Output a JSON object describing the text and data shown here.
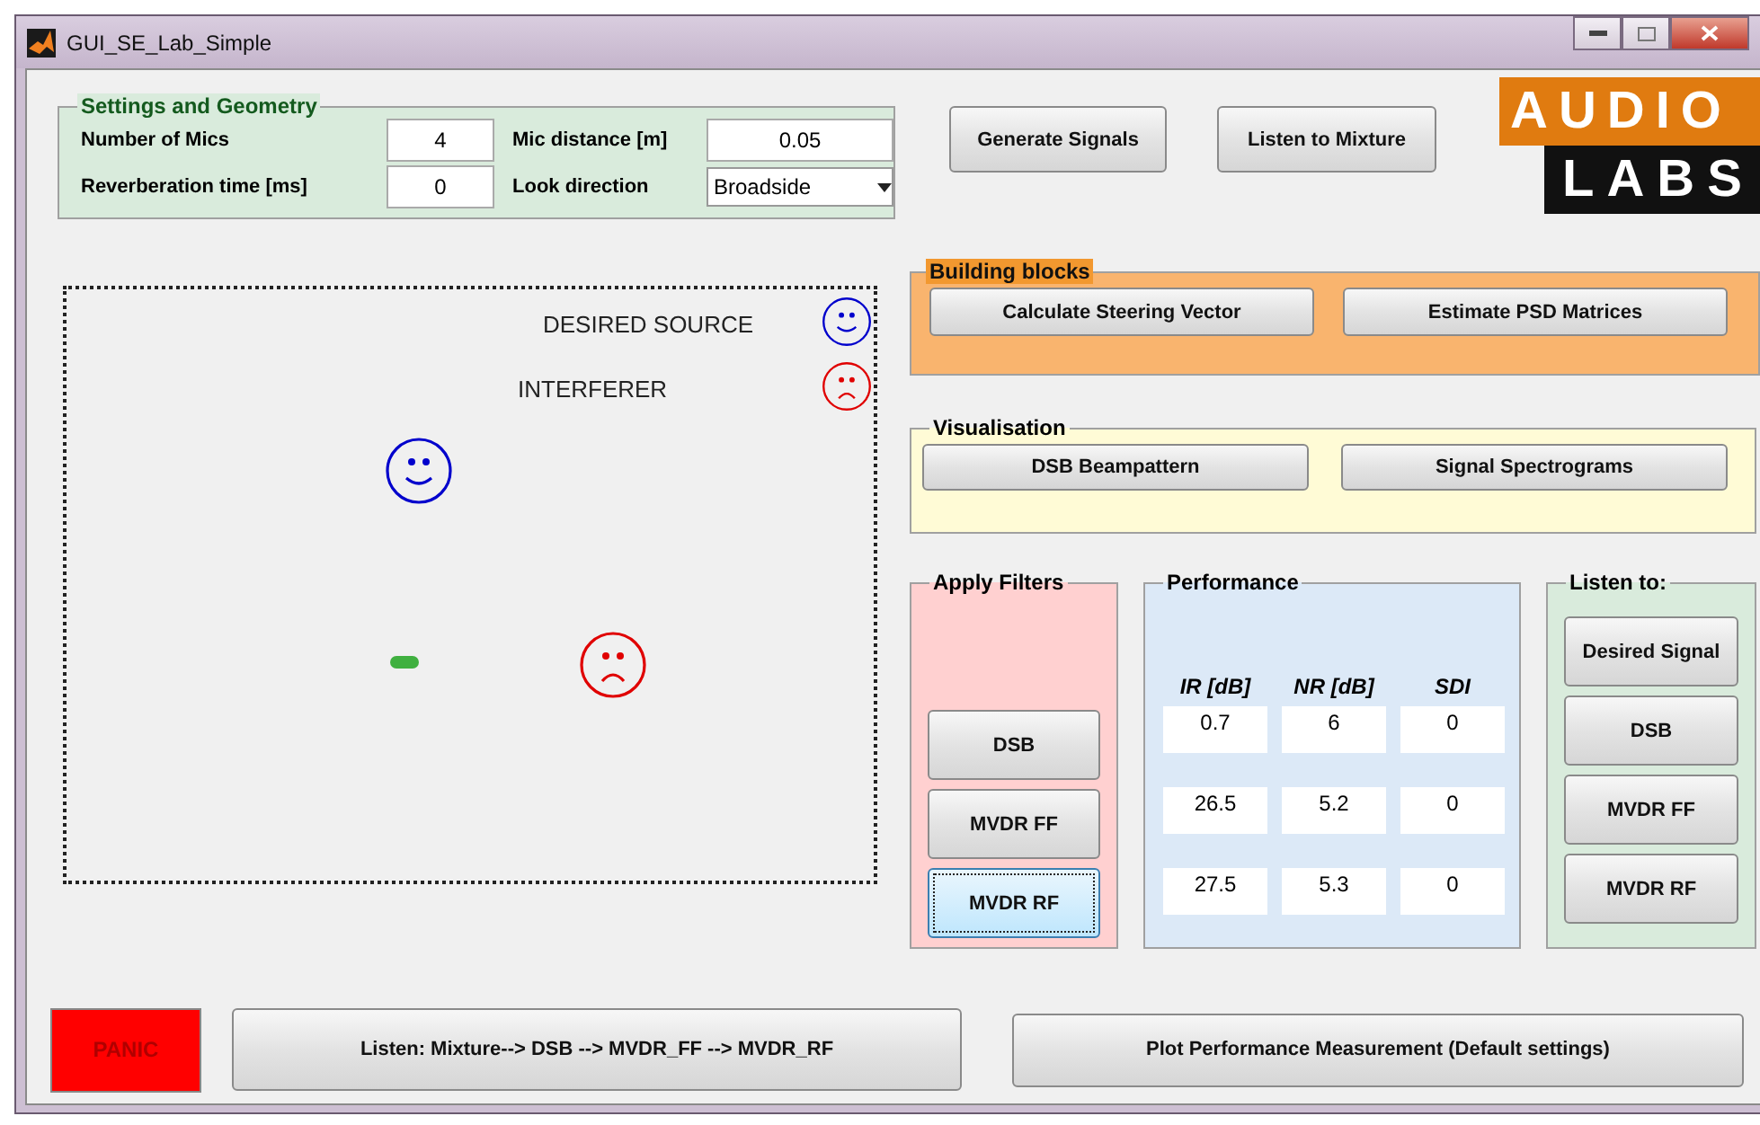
{
  "window": {
    "title": "GUI_SE_Lab_Simple"
  },
  "settings": {
    "title": "Settings and Geometry",
    "fields": [
      {
        "kind": "text",
        "label": "Number of Mics",
        "value": "4"
      },
      {
        "kind": "text",
        "label": "Mic distance [m]",
        "value": "0.05"
      },
      {
        "kind": "text",
        "label": "Reverberation time [ms]",
        "value": "0"
      },
      {
        "kind": "dropdown",
        "label": "Look direction",
        "value": "Broadside"
      }
    ]
  },
  "top_buttons": [
    "Generate Signals",
    "Listen to Mixture"
  ],
  "logo": {
    "line_1": "AUDIO",
    "line_2": "LABS"
  },
  "plot": {
    "legend": [
      {
        "label": "DESIRED SOURCE",
        "kind": "happy",
        "color": "#0000cc"
      },
      {
        "label": "INTERFERER",
        "kind": "sad",
        "color": "#e00000"
      }
    ]
  },
  "building_blocks": {
    "title": "Building blocks",
    "buttons": [
      "Calculate Steering Vector",
      "Estimate PSD Matrices"
    ]
  },
  "visualisation": {
    "title": "Visualisation",
    "buttons": [
      "DSB Beampattern",
      "Signal Spectrograms"
    ]
  },
  "apply_filters": {
    "title": "Apply Filters",
    "buttons": [
      {
        "label": "DSB",
        "selected": false
      },
      {
        "label": "MVDR FF",
        "selected": false
      },
      {
        "label": "MVDR RF",
        "selected": true
      }
    ]
  },
  "performance": {
    "title": "Performance",
    "columns": [
      "IR [dB]",
      "NR [dB]",
      "SDI"
    ],
    "rows": [
      [
        "0.7",
        "6",
        "0"
      ],
      [
        "26.5",
        "5.2",
        "0"
      ],
      [
        "27.5",
        "5.3",
        "0"
      ]
    ]
  },
  "listen_to": {
    "title": "Listen to:",
    "buttons": [
      "Desired Signal",
      "DSB",
      "MVDR FF",
      "MVDR RF"
    ]
  },
  "bottom": {
    "panic": "PANIC",
    "buttons": [
      "Listen: Mixture--> DSB --> MVDR_FF --> MVDR_RF",
      "Plot Performance Measurement (Default settings)"
    ]
  }
}
